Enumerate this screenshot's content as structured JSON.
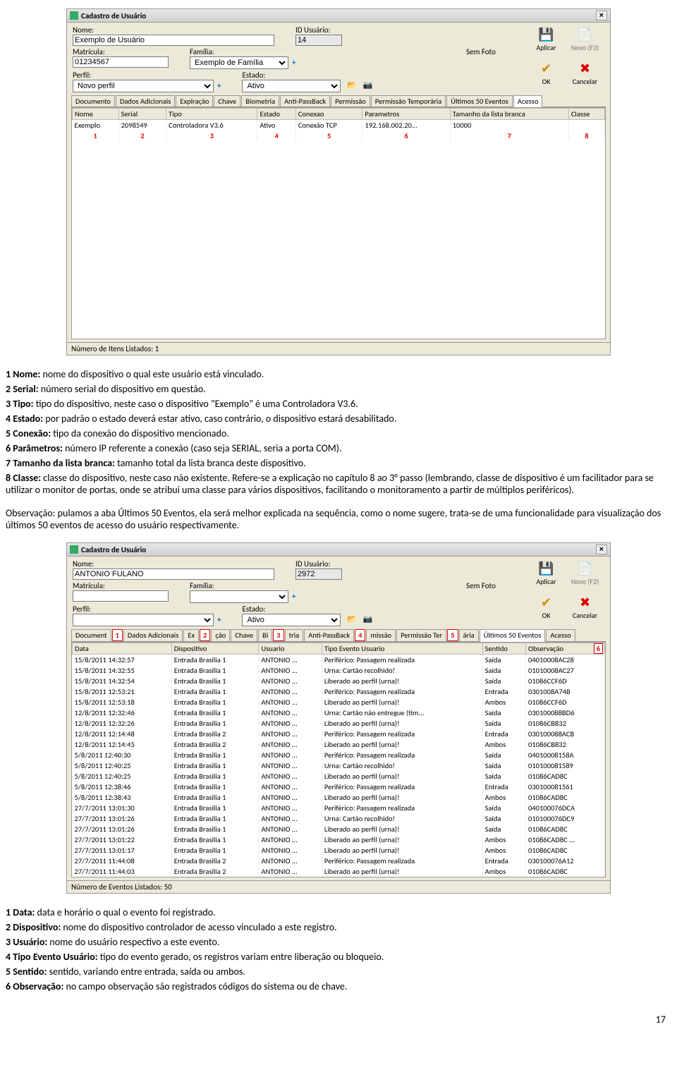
{
  "win1": {
    "title": "Cadastro de Usuário",
    "labels": {
      "nome": "Nome:",
      "id": "ID Usuário:",
      "mat": "Matrícula:",
      "fam": "Família:",
      "perfil": "Perfil:",
      "estado": "Estado:",
      "semfoto": "Sem Foto"
    },
    "values": {
      "nome": "Exemplo de Usuário",
      "id": "14",
      "mat": "01234567",
      "fam": "Exemplo de Família",
      "perfil": "Novo perfil",
      "estado": "Ativo"
    },
    "btns": {
      "aplicar": "Aplicar",
      "novo": "Novo (F2)",
      "ok": "OK",
      "cancelar": "Cancelar"
    },
    "tabs": [
      "Documento",
      "Dados Adicionais",
      "Expiração",
      "Chave",
      "Biometria",
      "Anti-PassBack",
      "Permissão",
      "Permissão Temporária",
      "Últimos 50 Eventos",
      "Acesso"
    ],
    "active_tab": "Acesso",
    "cols": [
      "Nome",
      "Serial",
      "Tipo",
      "Estado",
      "Conexao",
      "Parametros",
      "Tamanho da lista branca",
      "Classe"
    ],
    "row": [
      "Exemplo",
      "2098549",
      "Controladora V3.6",
      "Ativo",
      "Conexão TCP",
      "192.168.002.20...",
      "10000",
      ""
    ],
    "nums": [
      "1",
      "2",
      "3",
      "4",
      "5",
      "6",
      "7",
      "8"
    ],
    "status": "Número de Itens Listados:  1"
  },
  "desc1": [
    {
      "n": "1",
      "b": "Nome:",
      "t": " nome do dispositivo o qual este usuário está vinculado."
    },
    {
      "n": "2",
      "b": "Serial:",
      "t": " número serial do dispositivo em questão."
    },
    {
      "n": "3",
      "b": "Tipo:",
      "t": " tipo do dispositivo, neste caso o dispositivo \"Exemplo\" é uma Controladora V3.6."
    },
    {
      "n": "4",
      "b": "Estado:",
      "t": " por padrão o estado deverá estar ativo, caso contrário, o dispositivo estará desabilitado."
    },
    {
      "n": "5",
      "b": "Conexão:",
      "t": " tipo da conexão do dispositivo mencionado."
    },
    {
      "n": "6",
      "b": "Parâmetros:",
      "t": " número IP referente a conexão (caso seja SERIAL, seria a porta COM)."
    },
    {
      "n": "7",
      "b": "Tamanho da lista branca:",
      "t": " tamanho total da lista branca deste dispositivo."
    },
    {
      "n": "8",
      "b": "Classe:",
      "t": " classe do dispositivo, neste caso não existente. Refere-se a explicação no capítulo 8 ao 3° passo (lembrando, classe de dispositivo é um facilitador para se utilizar o monitor de portas, onde se atribui uma classe para vários dispositivos, facilitando o monitoramento a partir de múltiplos periféricos)."
    }
  ],
  "obs": "Observação: pulamos a aba Últimos 50 Eventos, ela será melhor explicada na sequência, como o nome sugere, trata-se de uma funcionalidade para visualização dos últimos 50 eventos de acesso do usuário respectivamente.",
  "win2": {
    "title": "Cadastro de Usuário",
    "labels": {
      "nome": "Nome:",
      "id": "ID Usuário:",
      "mat": "Matrícula:",
      "fam": "Família:",
      "perfil": "Perfil:",
      "estado": "Estado:",
      "semfoto": "Sem Foto"
    },
    "values": {
      "nome": "ANTONIO FULANO",
      "id": "2972",
      "mat": "",
      "fam": "",
      "perfil": "",
      "estado": "Ativo"
    },
    "btns": {
      "aplicar": "Aplicar",
      "novo": "Novo (F2)",
      "ok": "OK",
      "cancelar": "Cancelar"
    },
    "tab_fragments": [
      "Document",
      "Dados Adicionais",
      "Ex",
      "ção",
      "Chave",
      "Bi",
      "tria",
      "Anti-PassBack",
      "missão",
      "Permissão Ter",
      "ária",
      "Últimos 50 Eventos",
      "Acesso"
    ],
    "markers": [
      "1",
      "2",
      "3",
      "4",
      "5",
      "6"
    ],
    "cols": [
      "Data",
      "Dispositivo",
      "Usuario",
      "Tipo Evento Usuario",
      "Sentido",
      "Observação"
    ],
    "rows": [
      [
        "15/8/2011 14:32:57",
        "Entrada Brasilia 1",
        "ANTONIO ...",
        "Periférico: Passagem realizada",
        "Saída",
        "04010008AC28"
      ],
      [
        "15/8/2011 14:32:55",
        "Entrada Brasilia 1",
        "ANTONIO ...",
        "Urna: Cartão recolhido!",
        "Saída",
        "01010008AC27"
      ],
      [
        "15/8/2011 14:32:54",
        "Entrada Brasilia 1",
        "ANTONIO ...",
        "Liberado ao perfil (urna)!",
        "Saída",
        "01086CCF6D"
      ],
      [
        "15/8/2011 12:53:21",
        "Entrada Brasilia 1",
        "ANTONIO ...",
        "Periférico: Passagem realizada",
        "Entrada",
        "0301008A74B"
      ],
      [
        "15/8/2011 12:53:18",
        "Entrada Brasilia 1",
        "ANTONIO ...",
        "Liberado ao perfil (urna)!",
        "Ambos",
        "01086CCF6D"
      ],
      [
        "12/8/2011 12:32:46",
        "Entrada Brasilia 1",
        "ANTONIO ...",
        "Urna: Cartão não entregue (tim...",
        "Saída",
        "030100088BD6"
      ],
      [
        "12/8/2011 12:32:26",
        "Entrada Brasilia 1",
        "ANTONIO ...",
        "Liberado ao perfil (urna)!",
        "Saída",
        "01086CB832"
      ],
      [
        "12/8/2011 12:14:48",
        "Entrada Brasilia 2",
        "ANTONIO ...",
        "Periférico: Passagem realizada",
        "Entrada",
        "030100088ACB"
      ],
      [
        "12/8/2011 12:14:45",
        "Entrada Brasilia 2",
        "ANTONIO ...",
        "Liberado ao perfil (urna)!",
        "Ambos",
        "01086CB832"
      ],
      [
        "5/8/2011 12:40:30",
        "Entrada Brasilia 1",
        "ANTONIO ...",
        "Periférico: Passagem realizada",
        "Saída",
        "04010008158A"
      ],
      [
        "5/8/2011 12:40:25",
        "Entrada Brasilia 1",
        "ANTONIO ...",
        "Urna: Cartão recolhido!",
        "Saída",
        "010100081589"
      ],
      [
        "5/8/2011 12:40:25",
        "Entrada Brasilia 1",
        "ANTONIO ...",
        "Liberado ao perfil (urna)!",
        "Saída",
        "01086CAD8C"
      ],
      [
        "5/8/2011 12:38:46",
        "Entrada Brasilia 1",
        "ANTONIO ...",
        "Periférico: Passagem realizada",
        "Entrada",
        "030100081561"
      ],
      [
        "5/8/2011 12:38:43",
        "Entrada Brasilia 1",
        "ANTONIO ...",
        "Liberado ao perfil (urna)!",
        "Ambos",
        "01086CAD8C"
      ],
      [
        "27/7/2011 13:01:30",
        "Entrada Brasilia 1",
        "ANTONIO ...",
        "Periférico: Passagem realizada",
        "Saída",
        "040100076DCA"
      ],
      [
        "27/7/2011 13:01:26",
        "Entrada Brasilia 1",
        "ANTONIO ...",
        "Urna: Cartão recolhido!",
        "Saída",
        "010100076DC9"
      ],
      [
        "27/7/2011 13:01:26",
        "Entrada Brasilia 1",
        "ANTONIO ...",
        "Liberado ao perfil (urna)!",
        "Saída",
        "01086CAD8C"
      ],
      [
        "27/7/2011 13:01:22",
        "Entrada Brasilia 1",
        "ANTONIO ...",
        "Liberado ao perfil (urna)!",
        "Ambos",
        "01086CAD8C ..."
      ],
      [
        "27/7/2011 13:01:17",
        "Entrada Brasilia 1",
        "ANTONIO ...",
        "Liberado ao perfil (urna)!",
        "Ambos",
        "01086CAD8C"
      ],
      [
        "27/7/2011 11:44:08",
        "Entrada Brasilia 2",
        "ANTONIO ...",
        "Periférico: Passagem realizada",
        "Entrada",
        "030100076A12"
      ],
      [
        "27/7/2011 11:44:03",
        "Entrada Brasilia 2",
        "ANTONIO ...",
        "Liberado ao perfil (urna)!",
        "Ambos",
        "01086CAD8C"
      ]
    ],
    "status": "Número de Eventos Listados:  50"
  },
  "desc2": [
    {
      "n": "1",
      "b": "Data:",
      "t": " data e horário o qual o evento foi registrado."
    },
    {
      "n": "2",
      "b": "Dispositivo:",
      "t": " nome do dispositivo controlador de acesso vinculado a este registro."
    },
    {
      "n": "3",
      "b": "Usuário:",
      "t": " nome do usuário respectivo a este evento."
    },
    {
      "n": "4",
      "b": "Tipo Evento Usuário:",
      "t": " tipo do evento gerado, os registros variam entre liberação ou bloqueio."
    },
    {
      "n": "5",
      "b": "Sentido:",
      "t": " sentido, variando entre entrada, saída ou ambos."
    },
    {
      "n": "6",
      "b": "Observação:",
      "t": " no campo observação são registrados códigos do sistema ou de chave."
    }
  ],
  "page": "17"
}
